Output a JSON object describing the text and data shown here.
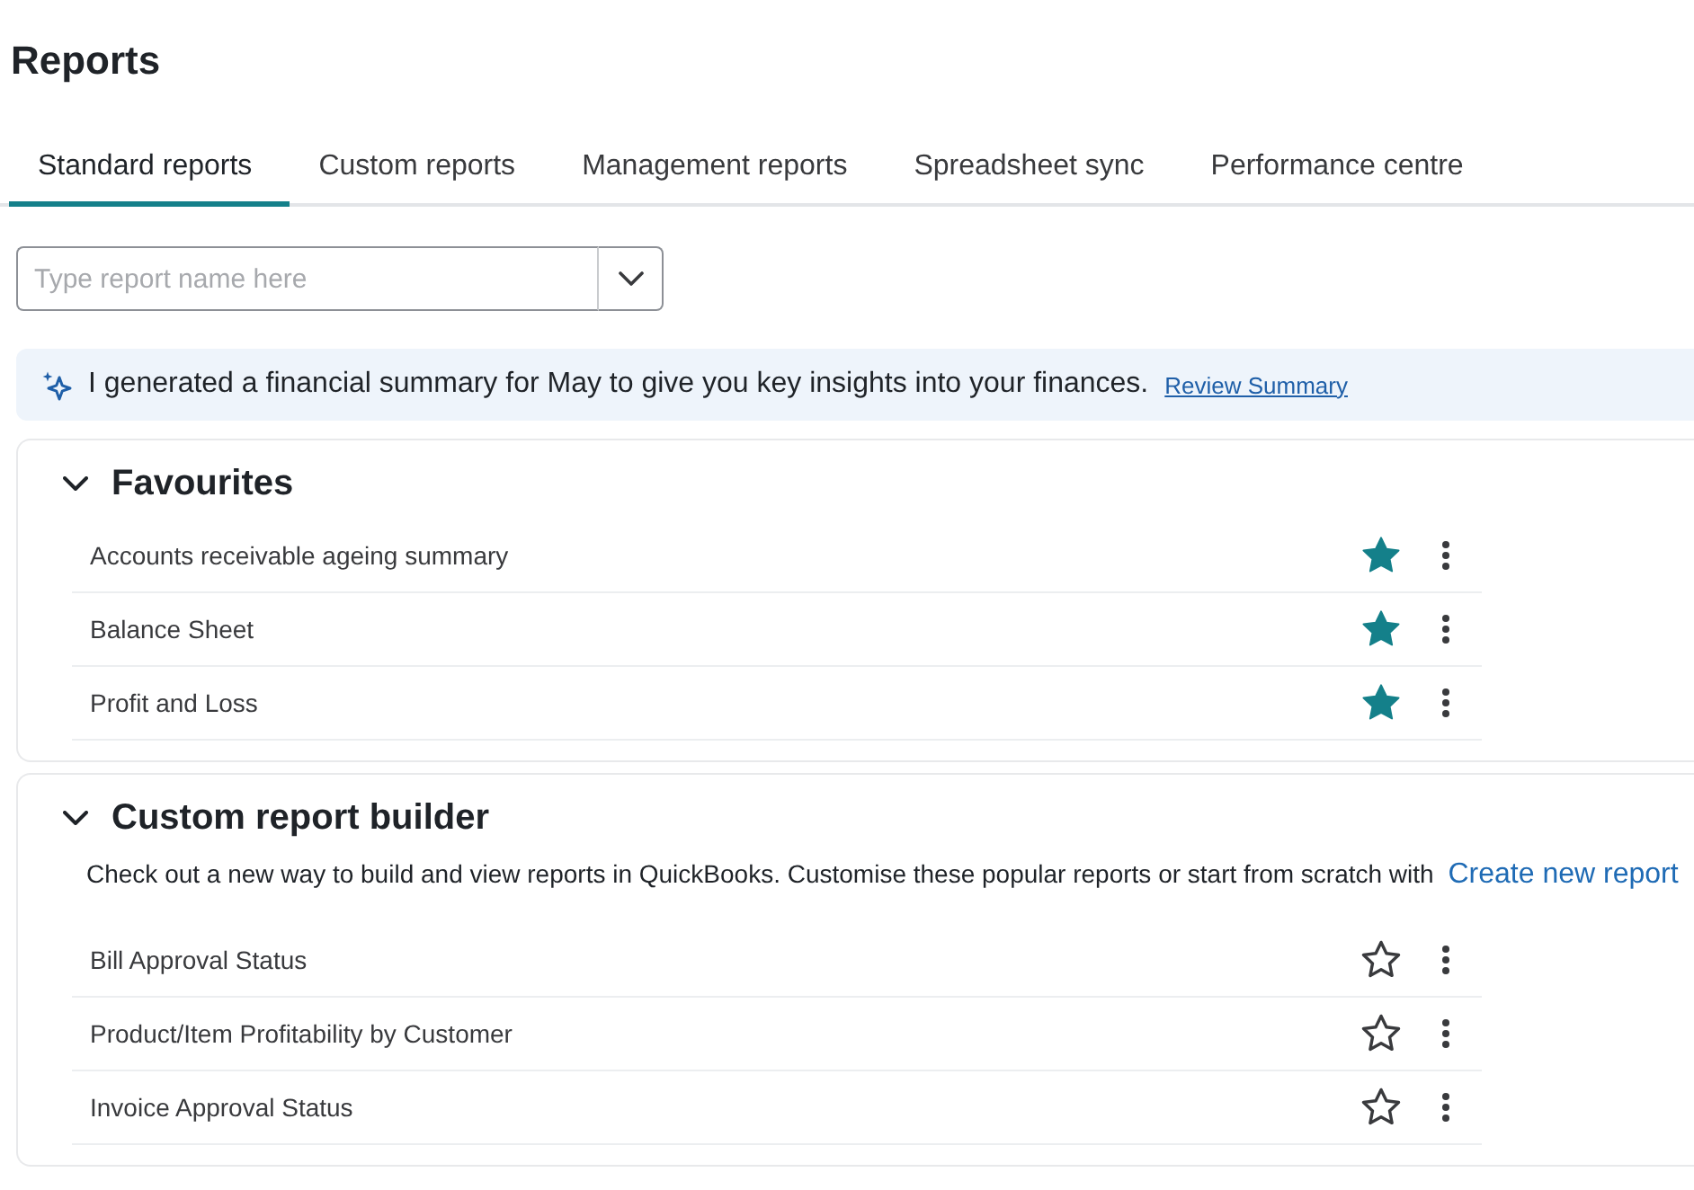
{
  "page": {
    "title": "Reports"
  },
  "tabs": [
    {
      "label": "Standard reports",
      "selected": true
    },
    {
      "label": "Custom reports",
      "selected": false
    },
    {
      "label": "Management reports",
      "selected": false
    },
    {
      "label": "Spreadsheet sync",
      "selected": false
    },
    {
      "label": "Performance centre",
      "selected": false
    }
  ],
  "search": {
    "placeholder": "Type report name here"
  },
  "banner": {
    "text": "I generated a financial summary for May to give you key insights into your finances.",
    "link": "Review Summary"
  },
  "sections": [
    {
      "title": "Favourites",
      "expanded": true,
      "reports": [
        {
          "name": "Accounts receivable ageing summary",
          "favourite": true
        },
        {
          "name": "Balance Sheet",
          "favourite": true
        },
        {
          "name": "Profit and Loss",
          "favourite": true
        }
      ]
    },
    {
      "title": "Custom report builder",
      "expanded": true,
      "description": "Check out a new way to build and view reports in QuickBooks. Customise these popular reports or start from scratch with",
      "link": "Create new report",
      "reports": [
        {
          "name": "Bill Approval Status",
          "favourite": false
        },
        {
          "name": "Product/Item Profitability by Customer",
          "favourite": false
        },
        {
          "name": "Invoice Approval Status",
          "favourite": false
        }
      ]
    }
  ]
}
